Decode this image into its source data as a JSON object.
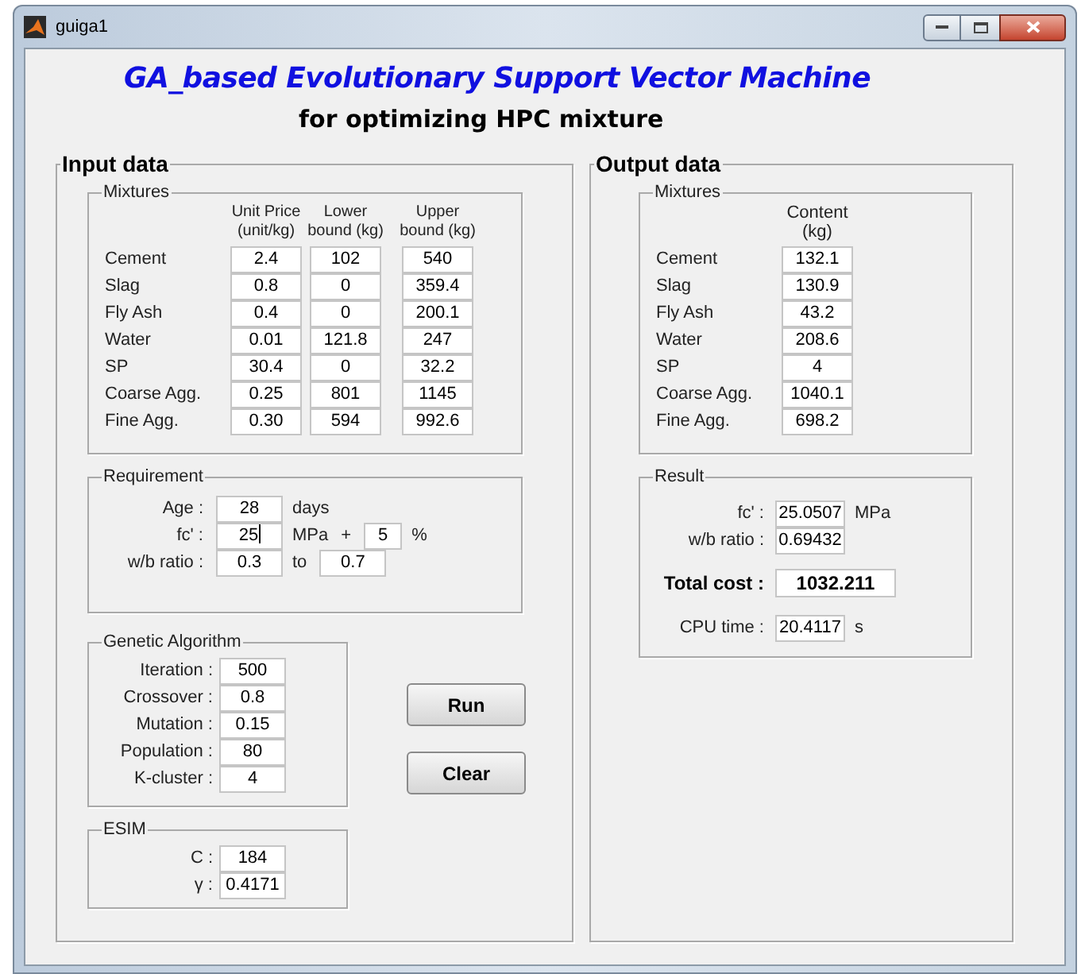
{
  "window": {
    "title": "guiga1"
  },
  "heading": {
    "title": "GA_based Evolutionary Support Vector Machine",
    "subtitle": "for optimizing HPC mixture"
  },
  "input_data": {
    "title": "Input data",
    "mixtures": {
      "title": "Mixtures",
      "columns": [
        {
          "lines": [
            "Unit Price",
            "(unit/kg)"
          ]
        },
        {
          "lines": [
            "Lower",
            "bound (kg)"
          ]
        },
        {
          "lines": [
            "Upper",
            "bound (kg)"
          ]
        }
      ],
      "rows": [
        {
          "label": "Cement",
          "values": [
            "2.4",
            "102",
            "540"
          ]
        },
        {
          "label": "Slag",
          "values": [
            "0.8",
            "0",
            "359.4"
          ]
        },
        {
          "label": "Fly Ash",
          "values": [
            "0.4",
            "0",
            "200.1"
          ]
        },
        {
          "label": "Water",
          "values": [
            "0.01",
            "121.8",
            "247"
          ]
        },
        {
          "label": "SP",
          "values": [
            "30.4",
            "0",
            "32.2"
          ]
        },
        {
          "label": "Coarse Agg.",
          "values": [
            "0.25",
            "801",
            "1145"
          ]
        },
        {
          "label": "Fine Agg.",
          "values": [
            "0.30",
            "594",
            "992.6"
          ]
        }
      ]
    },
    "requirement": {
      "title": "Requirement",
      "rows": [
        {
          "label": "Age :",
          "items": [
            {
              "kind": "field",
              "value": "28",
              "focused": false
            },
            {
              "kind": "text",
              "text": "days"
            }
          ]
        },
        {
          "label": "fc' :",
          "items": [
            {
              "kind": "field",
              "value": "25",
              "focused": true
            },
            {
              "kind": "text",
              "text": "MPa"
            },
            {
              "kind": "text",
              "text": "+"
            },
            {
              "kind": "small_field",
              "value": "5",
              "focused": false
            },
            {
              "kind": "text",
              "text": "%"
            }
          ]
        },
        {
          "label": "w/b ratio :",
          "items": [
            {
              "kind": "field",
              "value": "0.3",
              "focused": false
            },
            {
              "kind": "text",
              "text": "to"
            },
            {
              "kind": "field",
              "value": "0.7",
              "focused": false
            }
          ]
        }
      ]
    },
    "genetic_algorithm": {
      "title": "Genetic Algorithm",
      "params": [
        {
          "label": "Iteration :",
          "value": "500"
        },
        {
          "label": "Crossover :",
          "value": "0.8"
        },
        {
          "label": "Mutation :",
          "value": "0.15"
        },
        {
          "label": "Population :",
          "value": "80"
        },
        {
          "label": "K-cluster :",
          "value": "4"
        }
      ]
    },
    "esim": {
      "title": "ESIM",
      "params": [
        {
          "label": "C :",
          "value": "184"
        },
        {
          "label": "γ :",
          "value": "0.4171"
        }
      ]
    },
    "buttons": [
      {
        "label": "Run"
      },
      {
        "label": "Clear"
      }
    ]
  },
  "output_data": {
    "title": "Output data",
    "mixtures": {
      "title": "Mixtures",
      "column": [
        "Content",
        "(kg)"
      ],
      "rows": [
        {
          "label": "Cement",
          "value": "132.1"
        },
        {
          "label": "Slag",
          "value": "130.9"
        },
        {
          "label": "Fly Ash",
          "value": "43.2"
        },
        {
          "label": "Water",
          "value": "208.6"
        },
        {
          "label": "SP",
          "value": "4"
        },
        {
          "label": "Coarse Agg.",
          "value": "1040.1"
        },
        {
          "label": "Fine Agg.",
          "value": "698.2"
        }
      ]
    },
    "result": {
      "title": "Result",
      "rows": [
        {
          "kind": "field",
          "label": "fc' :",
          "value": "25.0507",
          "unit": "MPa"
        },
        {
          "kind": "field",
          "label": "w/b ratio :",
          "value": "0.69432"
        },
        {
          "kind": "total",
          "label": "Total cost :",
          "value": "1032.211"
        },
        {
          "kind": "field",
          "label": "CPU time :",
          "value": "20.4117",
          "unit": "s"
        }
      ]
    }
  }
}
